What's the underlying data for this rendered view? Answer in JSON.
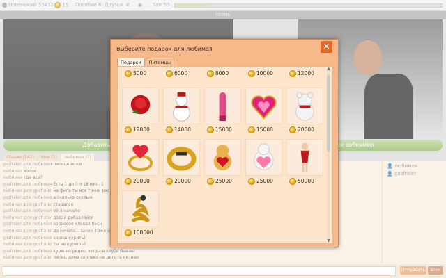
{
  "topbar": {
    "user": "Новенький 33432",
    "coins": "15",
    "nav_allowance": "Пособие К",
    "nav_friends": "Друзья",
    "nav_top": "Топ 50",
    "level_progress": 0.13
  },
  "room": {
    "name": "ПЕРМЬ"
  },
  "buttons": {
    "add_webcam": "Добавить вебкам",
    "search_webcam": "иск вебкамер"
  },
  "chat_tabs": [
    "Общий (542)",
    "Мои (1)",
    "любимая (3)"
  ],
  "chat_lines": [
    {
      "from": "gosfraler для",
      "to": "любимая",
      "text": "пипецкая ою"
    },
    {
      "from": "любимая",
      "to": "",
      "text": "хоооо"
    },
    {
      "from": "любимая",
      "to": "",
      "text": "где все?"
    },
    {
      "from": "gosfraler для",
      "to": "любимая",
      "text": "Есть 1 дн 5 ч 18 мин. 1"
    },
    {
      "from": "любимая для",
      "to": "gosfraler",
      "text": "на фига ты все точно рас"
    },
    {
      "from": "gosfraler для",
      "to": "любимая",
      "text": "а сколько сколько"
    },
    {
      "from": "любимая для",
      "to": "gosfraler",
      "text": "старался"
    },
    {
      "from": "gosfraler для",
      "to": "любимая",
      "text": "ой я начайю"
    },
    {
      "from": "любимая для",
      "to": "gosfraler",
      "text": "давай добавляйся"
    },
    {
      "from": "gosfraler для",
      "to": "любимая",
      "text": "оооооооо клевая песн"
    },
    {
      "from": "любимая для",
      "to": "gosfraler",
      "text": "да ничего... зачем тоже на"
    },
    {
      "from": "gosfraler для",
      "to": "любимая",
      "text": "хорош курить)"
    },
    {
      "from": "любимая для",
      "to": "gosfraler",
      "text": "ты не куришь?"
    },
    {
      "from": "gosfraler для",
      "to": "любимая",
      "text": "курю но редко, когда в клубе бываю"
    },
    {
      "from": "любимая для",
      "to": "gosfraler",
      "text": "пипец дома сколько не делать незнаю"
    }
  ],
  "users": [
    "любимая",
    "gosfraler"
  ],
  "input": {
    "send": "Отправить",
    "all": "всем"
  },
  "modal": {
    "title": "Выберите подарок для любимая",
    "close": "✕",
    "tabs": [
      "Подарки",
      "Питомцы"
    ],
    "top_prices": [
      "5000",
      "6000",
      "8000",
      "10000",
      "12000"
    ],
    "gifts": [
      {
        "price": "12000",
        "icon": "rose-icon"
      },
      {
        "price": "14000",
        "icon": "snowman-icon"
      },
      {
        "price": "15000",
        "icon": "pink-toy-icon"
      },
      {
        "price": "15000",
        "icon": "heart-jewel-icon"
      },
      {
        "price": "20000",
        "icon": "teddy-bear-icon"
      },
      {
        "price": "20000",
        "icon": "heart-ring-icon"
      },
      {
        "price": "20000",
        "icon": "gold-ring-icon"
      },
      {
        "price": "25000",
        "icon": "bear-with-heart-icon"
      },
      {
        "price": "25000",
        "icon": "bear-with-pillow-icon"
      },
      {
        "price": "50000",
        "icon": "santa-girl-icon"
      },
      {
        "price": "100000",
        "icon": "gold-snake-icon"
      }
    ]
  },
  "colors": {
    "accent": "#e06a2a",
    "modal_bg": "#f7b98a",
    "panel_bg": "#fde5cb"
  }
}
